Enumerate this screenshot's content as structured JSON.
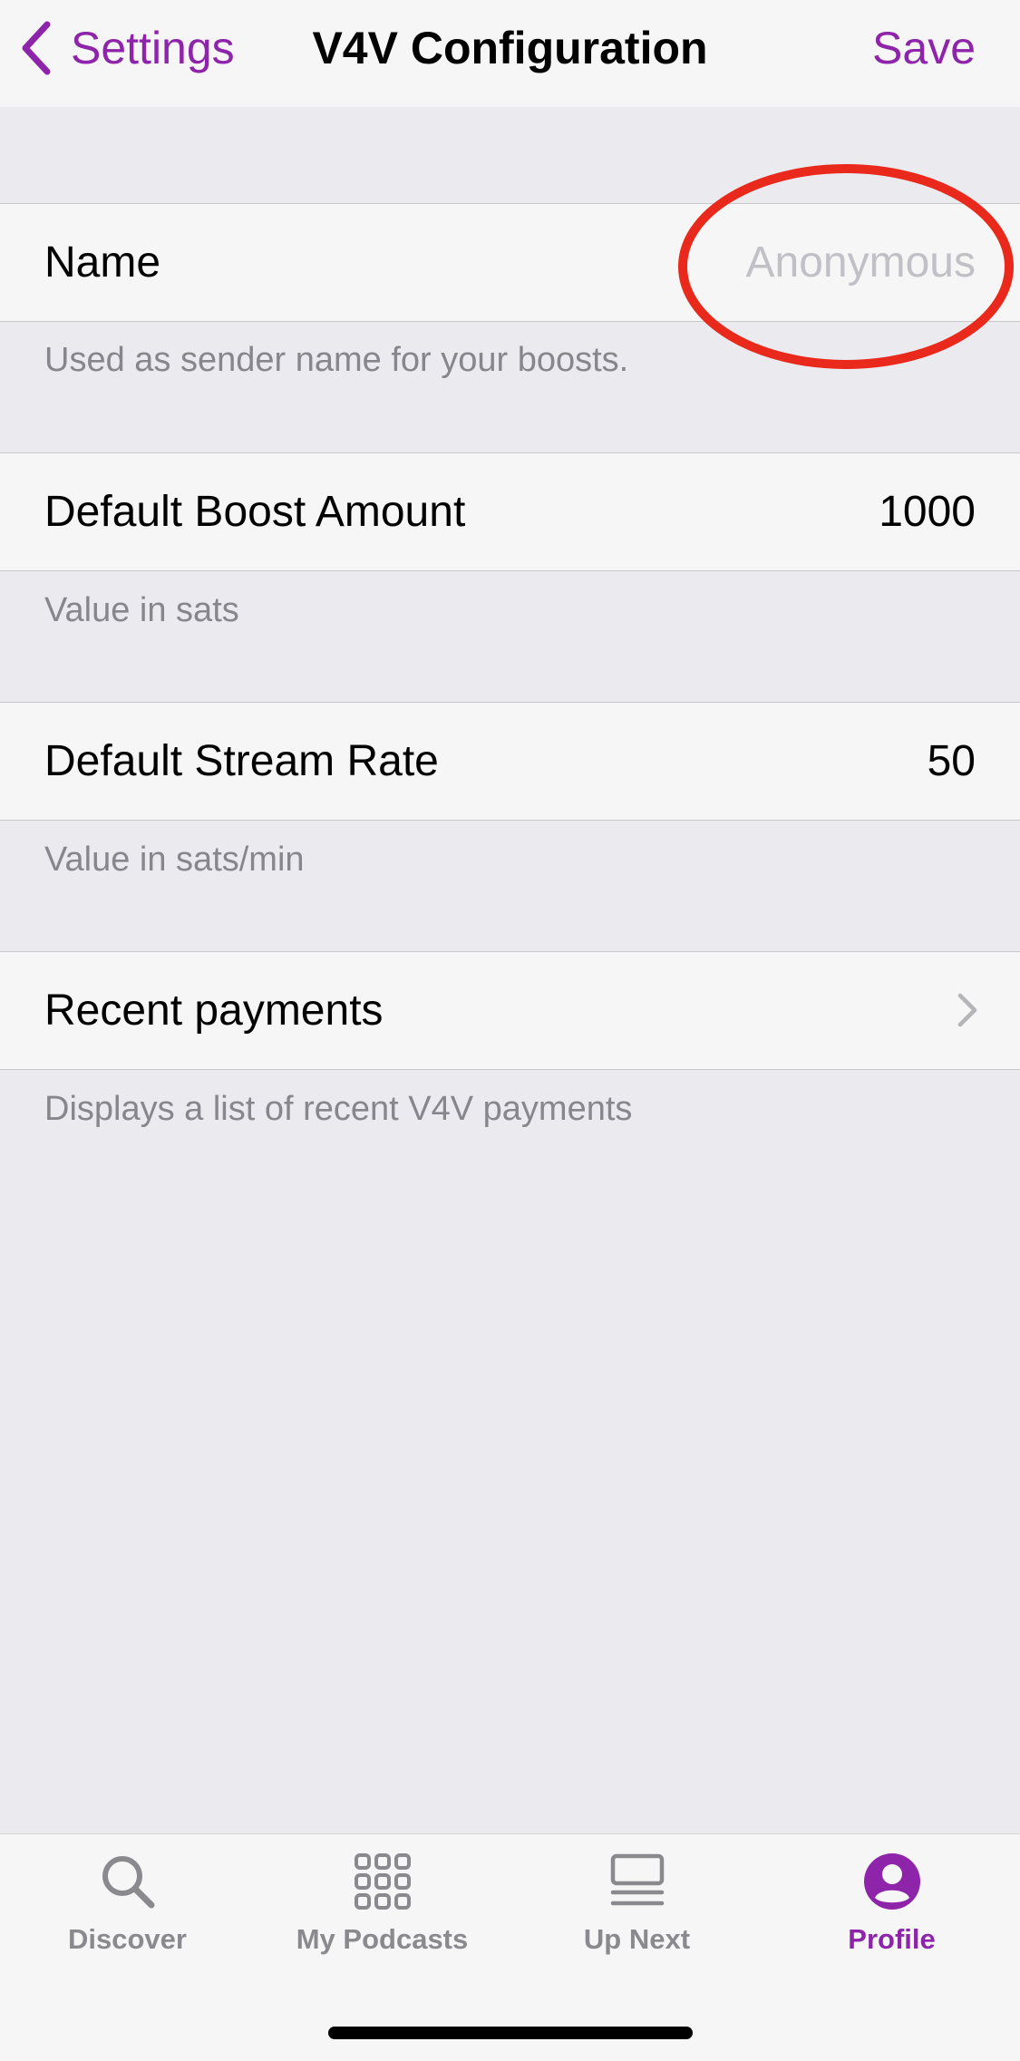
{
  "navbar": {
    "back_label": "Settings",
    "title": "V4V Configuration",
    "save_label": "Save"
  },
  "name_cell": {
    "label": "Name",
    "placeholder": "Anonymous",
    "footer": "Used as sender name for your boosts."
  },
  "boost_cell": {
    "label": "Default Boost Amount",
    "value": "1000",
    "footer": "Value in sats"
  },
  "stream_cell": {
    "label": "Default Stream Rate",
    "value": "50",
    "footer": "Value in sats/min"
  },
  "payments_cell": {
    "label": "Recent payments",
    "footer": "Displays a list of recent V4V payments"
  },
  "tabbar": {
    "tabs": [
      {
        "label": "Discover",
        "icon": "search-icon"
      },
      {
        "label": "My Podcasts",
        "icon": "grid-icon"
      },
      {
        "label": "Up Next",
        "icon": "queue-icon"
      },
      {
        "label": "Profile",
        "icon": "profile-icon"
      }
    ],
    "active_tab": "Profile"
  },
  "colors": {
    "accent": "#8e24aa",
    "highlight": "#e8291c",
    "background": "#ebeaef",
    "cell": "#f6f6f6",
    "secondary_text": "#86868c",
    "placeholder": "#c0c0c6"
  }
}
